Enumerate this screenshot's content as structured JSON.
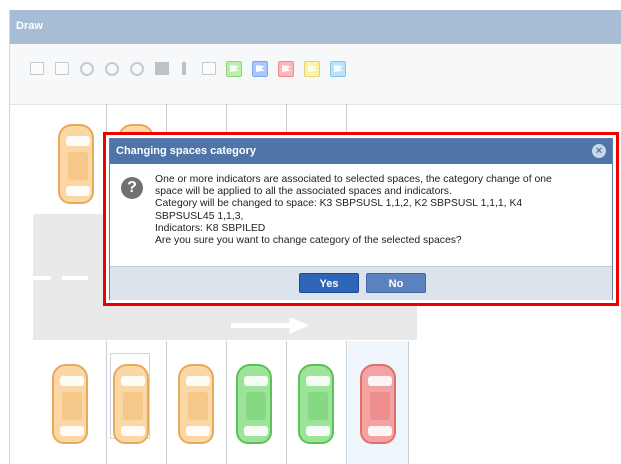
{
  "window": {
    "title": "Draw"
  },
  "toolbar": {
    "tools": [
      "edit-icon",
      "select-icon",
      "zoom-in-icon",
      "zoom-out-icon",
      "zoom-fit-icon",
      "fill-icon",
      "info-icon",
      "calendar-icon"
    ],
    "flags": [
      {
        "name": "flag-green-icon",
        "color": "#b9f0a8"
      },
      {
        "name": "flag-blue-icon",
        "color": "#a9c7ff"
      },
      {
        "name": "flag-red-icon",
        "color": "#ffb6b6"
      },
      {
        "name": "flag-yellow-icon",
        "color": "#fff2a3"
      },
      {
        "name": "flag-lightblue-icon",
        "color": "#b8e3ff"
      }
    ]
  },
  "canvas": {
    "cars_top": [
      "orange",
      "orange"
    ],
    "cars_bottom": [
      "orange",
      "orange",
      "orange",
      "green",
      "green",
      "red"
    ]
  },
  "dialog": {
    "title": "Changing spaces category",
    "message_lines": [
      "One or more indicators are associated to selected spaces, the category change of one",
      "space will be applied to all the associated spaces and indicators.",
      "Category will be changed to space: K3 SBPSUSL 1,1,2, K2 SBPSUSL 1,1,1, K4",
      "SBPSUSL45 1,1,3,",
      "Indicators: K8 SBPILED",
      "Are you sure you want to change category of the selected spaces?"
    ],
    "yes_label": "Yes",
    "no_label": "No"
  },
  "colors": {
    "highlight_border": "#ee0000",
    "dialog_header": "#4f74a7",
    "window_header": "#a7bcd5"
  }
}
